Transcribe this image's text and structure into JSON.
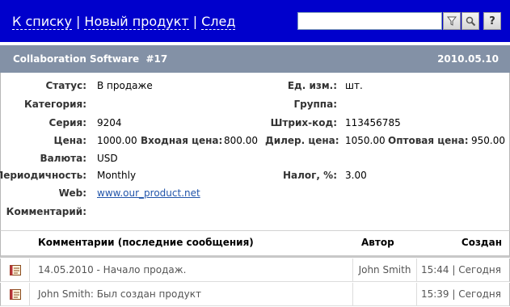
{
  "nav": {
    "to_list": "К списку",
    "new_product": "Новый продукт",
    "next": "След",
    "separator": "|"
  },
  "search": {
    "value": "",
    "placeholder": ""
  },
  "toolbar": {
    "help_label": "?"
  },
  "header": {
    "title": "Collaboration Software  #17",
    "date": "2010.05.10"
  },
  "fields": {
    "status_label": "Статус:",
    "status": "В продаже",
    "unit_label": "Ед. изм.:",
    "unit": "шт.",
    "category_label": "Категория:",
    "category": "",
    "group_label": "Группа:",
    "group": "",
    "series_label": "Серия:",
    "series": "9204",
    "barcode_label": "Штрих-код:",
    "barcode": "113456785",
    "price_label": "Цена:",
    "price": "1000.00",
    "input_price_label": "Входная цена:",
    "input_price": "800.00",
    "dealer_price_label": "Дилер. цена:",
    "dealer_price": "1050.00",
    "wholesale_price_label": "Оптовая цена:",
    "wholesale_price": "950.00",
    "currency_label": "Валюта:",
    "currency": "USD",
    "periodicity_label": "Периодичность:",
    "periodicity": "Monthly",
    "tax_label": "Налог, %:",
    "tax": "3.00",
    "web_label": "Web:",
    "web": "www.our_product.net",
    "comment_label": "Комментарий:",
    "comment": ""
  },
  "comments": {
    "col_comments": "Комментарии (последние сообщения)",
    "col_author": "Автор",
    "col_created": "Создан",
    "rows": [
      {
        "text": "14.05.2010 - Начало продаж.",
        "author": "John Smith",
        "created": "15:44 | Сегодня"
      },
      {
        "text": "John Smith: Был создан продукт",
        "author": "",
        "created": "15:39 | Сегодня"
      }
    ]
  }
}
